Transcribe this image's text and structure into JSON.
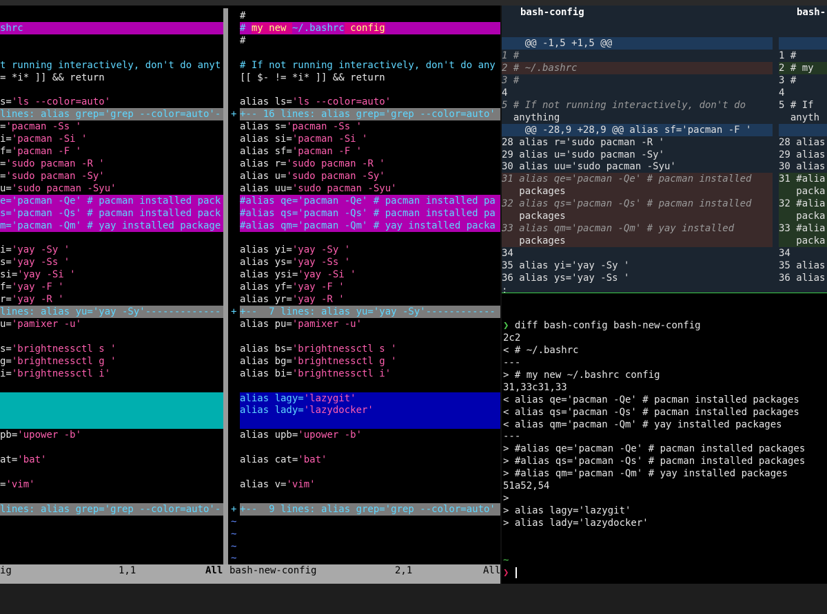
{
  "left_pane": {
    "lines": [
      {
        "segments": [
          {
            "t": "",
            "c": ""
          }
        ]
      },
      {
        "cls": "c-mag",
        "segments": [
          {
            "t": "shrc",
            "c": ""
          }
        ]
      },
      {
        "segments": [
          {
            "t": "",
            "c": ""
          }
        ]
      },
      {
        "segments": [
          {
            "t": "",
            "c": ""
          }
        ]
      },
      {
        "segments": [
          {
            "t": "t running interactively, don't do anyt",
            "c": "cmt"
          }
        ]
      },
      {
        "segments": [
          {
            "t": "= *i* ]] && return",
            "c": ""
          }
        ]
      },
      {
        "segments": [
          {
            "t": "",
            "c": ""
          }
        ]
      },
      {
        "segments": [
          {
            "t": "s=",
            "c": ""
          },
          {
            "t": "'ls --color=auto'",
            "c": "str"
          }
        ]
      },
      {
        "cls": "c-fold",
        "segments": [
          {
            "t": "lines: alias grep='grep --color=auto'-",
            "c": ""
          }
        ]
      },
      {
        "segments": [
          {
            "t": "=",
            "c": ""
          },
          {
            "t": "'pacman -Ss '",
            "c": "str"
          }
        ]
      },
      {
        "segments": [
          {
            "t": "i=",
            "c": ""
          },
          {
            "t": "'pacman -Si '",
            "c": "str"
          }
        ]
      },
      {
        "segments": [
          {
            "t": "f=",
            "c": ""
          },
          {
            "t": "'pacman -F '",
            "c": "str"
          }
        ]
      },
      {
        "segments": [
          {
            "t": "=",
            "c": ""
          },
          {
            "t": "'sudo pacman -R '",
            "c": "str"
          }
        ]
      },
      {
        "segments": [
          {
            "t": "=",
            "c": ""
          },
          {
            "t": "'sudo pacman -Sy'",
            "c": "str"
          }
        ]
      },
      {
        "segments": [
          {
            "t": "u=",
            "c": ""
          },
          {
            "t": "'sudo pacman -Syu'",
            "c": "str"
          }
        ]
      },
      {
        "cls": "c-mag",
        "segments": [
          {
            "t": "e='pacman -Qe' # pacman installed pack",
            "c": ""
          }
        ]
      },
      {
        "cls": "c-mag",
        "segments": [
          {
            "t": "s='pacman -Qs' # pacman installed pack",
            "c": ""
          }
        ]
      },
      {
        "cls": "c-mag",
        "segments": [
          {
            "t": "m='pacman -Qm' # yay installed package",
            "c": ""
          }
        ]
      },
      {
        "segments": [
          {
            "t": "",
            "c": ""
          }
        ]
      },
      {
        "segments": [
          {
            "t": "i=",
            "c": ""
          },
          {
            "t": "'yay -Sy '",
            "c": "str"
          }
        ]
      },
      {
        "segments": [
          {
            "t": "s=",
            "c": ""
          },
          {
            "t": "'yay -Ss '",
            "c": "str"
          }
        ]
      },
      {
        "segments": [
          {
            "t": "si=",
            "c": ""
          },
          {
            "t": "'yay -Si '",
            "c": "str"
          }
        ]
      },
      {
        "segments": [
          {
            "t": "f=",
            "c": ""
          },
          {
            "t": "'yay -F '",
            "c": "str"
          }
        ]
      },
      {
        "segments": [
          {
            "t": "r=",
            "c": ""
          },
          {
            "t": "'yay -R '",
            "c": "str"
          }
        ]
      },
      {
        "cls": "c-fold",
        "segments": [
          {
            "t": "lines: alias yu='yay -Sy'-------------",
            "c": ""
          }
        ]
      },
      {
        "segments": [
          {
            "t": "u=",
            "c": ""
          },
          {
            "t": "'pamixer -u'",
            "c": "str"
          }
        ]
      },
      {
        "segments": [
          {
            "t": "",
            "c": ""
          }
        ]
      },
      {
        "segments": [
          {
            "t": "s=",
            "c": ""
          },
          {
            "t": "'brightnessctl s '",
            "c": "str"
          }
        ]
      },
      {
        "segments": [
          {
            "t": "g=",
            "c": ""
          },
          {
            "t": "'brightnessctl g '",
            "c": "str"
          }
        ]
      },
      {
        "segments": [
          {
            "t": "i=",
            "c": ""
          },
          {
            "t": "'brightnessctl i'",
            "c": "str"
          }
        ]
      },
      {
        "segments": [
          {
            "t": "",
            "c": ""
          }
        ]
      },
      {
        "cls": "c-cyanb",
        "segments": [
          {
            "t": "",
            "c": ""
          }
        ]
      },
      {
        "cls": "c-cyanb",
        "segments": [
          {
            "t": "",
            "c": ""
          }
        ]
      },
      {
        "cls": "c-cyanb",
        "segments": [
          {
            "t": "",
            "c": ""
          }
        ]
      },
      {
        "segments": [
          {
            "t": "pb=",
            "c": ""
          },
          {
            "t": "'upower -b'",
            "c": "str"
          }
        ]
      },
      {
        "segments": [
          {
            "t": "",
            "c": ""
          }
        ]
      },
      {
        "segments": [
          {
            "t": "at=",
            "c": ""
          },
          {
            "t": "'bat'",
            "c": "str"
          }
        ]
      },
      {
        "segments": [
          {
            "t": "",
            "c": ""
          }
        ]
      },
      {
        "segments": [
          {
            "t": "=",
            "c": ""
          },
          {
            "t": "'vim'",
            "c": "str"
          }
        ]
      },
      {
        "segments": [
          {
            "t": "",
            "c": ""
          }
        ]
      },
      {
        "cls": "c-fold",
        "segments": [
          {
            "t": "lines: alias grep='grep --color=auto'-",
            "c": ""
          }
        ]
      }
    ],
    "status": {
      "name": "ig",
      "pos": "1,1",
      "scroll": "All"
    }
  },
  "gutter": {
    "lines": [
      "",
      "",
      "",
      "",
      "",
      "",
      "",
      "",
      "+",
      "",
      "",
      "",
      "",
      "",
      "",
      "",
      "",
      "",
      "",
      "",
      "",
      "",
      "",
      "",
      "+",
      "",
      "",
      "",
      "",
      "",
      "",
      "",
      "",
      "",
      "",
      "",
      "",
      "",
      "",
      "",
      "+",
      "~",
      "~",
      "~",
      "~"
    ]
  },
  "right_pane": {
    "lines": [
      {
        "segments": [
          {
            "t": "#",
            "c": ""
          }
        ]
      },
      {
        "cls": "c-mag",
        "segments": [
          {
            "t": "# ",
            "c": ""
          },
          {
            "t": "my new ",
            "c": "c-mag-hl"
          },
          {
            "t": "~/.bashrc",
            "c": ""
          },
          {
            "t": " config",
            "c": "c-mag-hl"
          }
        ]
      },
      {
        "segments": [
          {
            "t": "#",
            "c": ""
          }
        ]
      },
      {
        "segments": [
          {
            "t": "",
            "c": ""
          }
        ]
      },
      {
        "segments": [
          {
            "t": "# If not running interactively, don't do any",
            "c": "cmt"
          }
        ]
      },
      {
        "segments": [
          {
            "t": "[[ $- != *i* ]] && return",
            "c": ""
          }
        ]
      },
      {
        "segments": [
          {
            "t": "",
            "c": ""
          }
        ]
      },
      {
        "segments": [
          {
            "t": "alias ls=",
            "c": ""
          },
          {
            "t": "'ls --color=auto'",
            "c": "str"
          }
        ]
      },
      {
        "cls": "c-fold",
        "segments": [
          {
            "t": "+-- 16 lines: alias grep='grep --color=auto'",
            "c": ""
          }
        ]
      },
      {
        "segments": [
          {
            "t": "alias s=",
            "c": ""
          },
          {
            "t": "'pacman -Ss '",
            "c": "str"
          }
        ]
      },
      {
        "segments": [
          {
            "t": "alias si=",
            "c": ""
          },
          {
            "t": "'pacman -Si '",
            "c": "str"
          }
        ]
      },
      {
        "segments": [
          {
            "t": "alias sf=",
            "c": ""
          },
          {
            "t": "'pacman -F '",
            "c": "str"
          }
        ]
      },
      {
        "segments": [
          {
            "t": "alias r=",
            "c": ""
          },
          {
            "t": "'sudo pacman -R '",
            "c": "str"
          }
        ]
      },
      {
        "segments": [
          {
            "t": "alias u=",
            "c": ""
          },
          {
            "t": "'sudo pacman -Sy'",
            "c": "str"
          }
        ]
      },
      {
        "segments": [
          {
            "t": "alias uu=",
            "c": ""
          },
          {
            "t": "'sudo pacman -Syu'",
            "c": "str"
          }
        ]
      },
      {
        "cls": "c-mag",
        "segments": [
          {
            "t": "#alias qe='pacman -Qe' # pacman installed pa",
            "c": ""
          }
        ]
      },
      {
        "cls": "c-mag",
        "segments": [
          {
            "t": "#alias qs='pacman -Qs' # pacman installed pa",
            "c": ""
          }
        ]
      },
      {
        "cls": "c-mag",
        "segments": [
          {
            "t": "#alias qm='pacman -Qm' # yay installed packa",
            "c": ""
          }
        ]
      },
      {
        "segments": [
          {
            "t": "",
            "c": ""
          }
        ]
      },
      {
        "segments": [
          {
            "t": "alias yi=",
            "c": ""
          },
          {
            "t": "'yay -Sy '",
            "c": "str"
          }
        ]
      },
      {
        "segments": [
          {
            "t": "alias ys=",
            "c": ""
          },
          {
            "t": "'yay -Ss '",
            "c": "str"
          }
        ]
      },
      {
        "segments": [
          {
            "t": "alias ysi=",
            "c": ""
          },
          {
            "t": "'yay -Si '",
            "c": "str"
          }
        ]
      },
      {
        "segments": [
          {
            "t": "alias yf=",
            "c": ""
          },
          {
            "t": "'yay -F '",
            "c": "str"
          }
        ]
      },
      {
        "segments": [
          {
            "t": "alias yr=",
            "c": ""
          },
          {
            "t": "'yay -R '",
            "c": "str"
          }
        ]
      },
      {
        "cls": "c-fold",
        "segments": [
          {
            "t": "+--  7 lines: alias yu='yay -Sy'------------",
            "c": ""
          }
        ]
      },
      {
        "segments": [
          {
            "t": "alias pu=",
            "c": ""
          },
          {
            "t": "'pamixer -u'",
            "c": "str"
          }
        ]
      },
      {
        "segments": [
          {
            "t": "",
            "c": ""
          }
        ]
      },
      {
        "segments": [
          {
            "t": "alias bs=",
            "c": ""
          },
          {
            "t": "'brightnessctl s '",
            "c": "str"
          }
        ]
      },
      {
        "segments": [
          {
            "t": "alias bg=",
            "c": ""
          },
          {
            "t": "'brightnessctl g '",
            "c": "str"
          }
        ]
      },
      {
        "segments": [
          {
            "t": "alias bi=",
            "c": ""
          },
          {
            "t": "'brightnessctl i'",
            "c": "str"
          }
        ]
      },
      {
        "segments": [
          {
            "t": "",
            "c": ""
          }
        ]
      },
      {
        "cls": "c-blue",
        "segments": [
          {
            "t": "alias lagy=",
            "c": ""
          },
          {
            "t": "'lazygit'",
            "c": "str"
          }
        ]
      },
      {
        "cls": "c-blue",
        "segments": [
          {
            "t": "alias lady=",
            "c": ""
          },
          {
            "t": "'lazydocker'",
            "c": "str"
          }
        ]
      },
      {
        "cls": "c-blue",
        "segments": [
          {
            "t": "",
            "c": ""
          }
        ]
      },
      {
        "segments": [
          {
            "t": "alias upb=",
            "c": ""
          },
          {
            "t": "'upower -b'",
            "c": "str"
          }
        ]
      },
      {
        "segments": [
          {
            "t": "",
            "c": ""
          }
        ]
      },
      {
        "segments": [
          {
            "t": "alias cat=",
            "c": ""
          },
          {
            "t": "'bat'",
            "c": "str"
          }
        ]
      },
      {
        "segments": [
          {
            "t": "",
            "c": ""
          }
        ]
      },
      {
        "segments": [
          {
            "t": "alias v=",
            "c": ""
          },
          {
            "t": "'vim'",
            "c": "str"
          }
        ]
      },
      {
        "segments": [
          {
            "t": "",
            "c": ""
          }
        ]
      },
      {
        "cls": "c-fold",
        "segments": [
          {
            "t": "+--  9 lines: alias grep='grep --color=auto'",
            "c": ""
          }
        ]
      }
    ],
    "status": {
      "name": "bash-new-config",
      "pos": "2,1",
      "scroll": "All"
    }
  },
  "diff_view": {
    "header_left": "bash-config",
    "header_right": "bash-",
    "rows": [
      {
        "cls": "",
        "l": "",
        "r": ""
      },
      {
        "cls": "d-hunk",
        "l": "    @@ -1,5 +1,5 @@",
        "r": ""
      },
      {
        "cls": "",
        "l": "1 #",
        "r": "1 #"
      },
      {
        "cls": "d-del",
        "l": "2 # ~/.bashrc",
        "r": "2 # my",
        "rcls": "d-add"
      },
      {
        "cls": "",
        "l": "3 #",
        "r": "3 #"
      },
      {
        "cls": "",
        "l": "4",
        "r": "4"
      },
      {
        "cls": "",
        "l": "5 # If not running interactively, don't do",
        "r": "5 # If"
      },
      {
        "cls": "",
        "l": "  anything",
        "r": "  anyth"
      },
      {
        "cls": "d-hunk",
        "l": "    @@ -28,9 +28,9 @@ alias sf='pacman -F '",
        "r": ""
      },
      {
        "cls": "",
        "l": "28 alias r='sudo pacman -R '",
        "r": "28 alias"
      },
      {
        "cls": "",
        "l": "29 alias u='sudo pacman -Sy'",
        "r": "29 alias"
      },
      {
        "cls": "",
        "l": "30 alias uu='sudo pacman -Syu'",
        "r": "30 alias"
      },
      {
        "cls": "d-del",
        "l": "31 alias qe='pacman -Qe' # pacman installed",
        "r": "31 #alia",
        "rcls": "d-add"
      },
      {
        "cls": "d-del",
        "l": "   packages",
        "r": "   packa",
        "rcls": "d-add"
      },
      {
        "cls": "d-del",
        "l": "32 alias qs='pacman -Qs' # pacman installed",
        "r": "32 #alia",
        "rcls": "d-add"
      },
      {
        "cls": "d-del",
        "l": "   packages",
        "r": "   packa",
        "rcls": "d-add"
      },
      {
        "cls": "d-del",
        "l": "33 alias qm='pacman -Qm' # yay installed",
        "r": "33 #alia",
        "rcls": "d-add"
      },
      {
        "cls": "d-del",
        "l": "   packages",
        "r": "   packa",
        "rcls": "d-add"
      },
      {
        "cls": "",
        "l": "34",
        "r": "34"
      },
      {
        "cls": "",
        "l": "35 alias yi='yay -Sy '",
        "r": "35 alias"
      },
      {
        "cls": "",
        "l": "36 alias ys='yay -Ss '",
        "r": "36 alias"
      },
      {
        "cls": "",
        "l": ":",
        "r": ""
      }
    ]
  },
  "terminal": {
    "lines": [
      {
        "t": "",
        "c": "t"
      },
      {
        "t": "",
        "c": "t"
      },
      {
        "t": "❯ diff bash-config bash-new-config",
        "c": "t",
        "prompt": true
      },
      {
        "t": "2c2",
        "c": "t"
      },
      {
        "t": "< # ~/.bashrc",
        "c": "t"
      },
      {
        "t": "---",
        "c": "t"
      },
      {
        "t": "> # my new ~/.bashrc config",
        "c": "t"
      },
      {
        "t": "31,33c31,33",
        "c": "t"
      },
      {
        "t": "< alias qe='pacman -Qe' # pacman installed packages",
        "c": "t"
      },
      {
        "t": "< alias qs='pacman -Qs' # pacman installed packages",
        "c": "t"
      },
      {
        "t": "< alias qm='pacman -Qm' # yay installed packages",
        "c": "t"
      },
      {
        "t": "---",
        "c": "t"
      },
      {
        "t": "> #alias qe='pacman -Qe' # pacman installed packages",
        "c": "t"
      },
      {
        "t": "> #alias qs='pacman -Qs' # pacman installed packages",
        "c": "t"
      },
      {
        "t": "> #alias qm='pacman -Qm' # yay installed packages",
        "c": "t"
      },
      {
        "t": "51a52,54",
        "c": "t"
      },
      {
        "t": ">",
        "c": "t"
      },
      {
        "t": "> alias lagy='lazygit'",
        "c": "t"
      },
      {
        "t": "> alias lady='lazydocker'",
        "c": "t"
      },
      {
        "t": "",
        "c": "t"
      },
      {
        "t": "",
        "c": "t"
      },
      {
        "t": "~",
        "c": "prompt"
      },
      {
        "t": "❯",
        "c": "prompt2",
        "cursor": true
      }
    ]
  }
}
